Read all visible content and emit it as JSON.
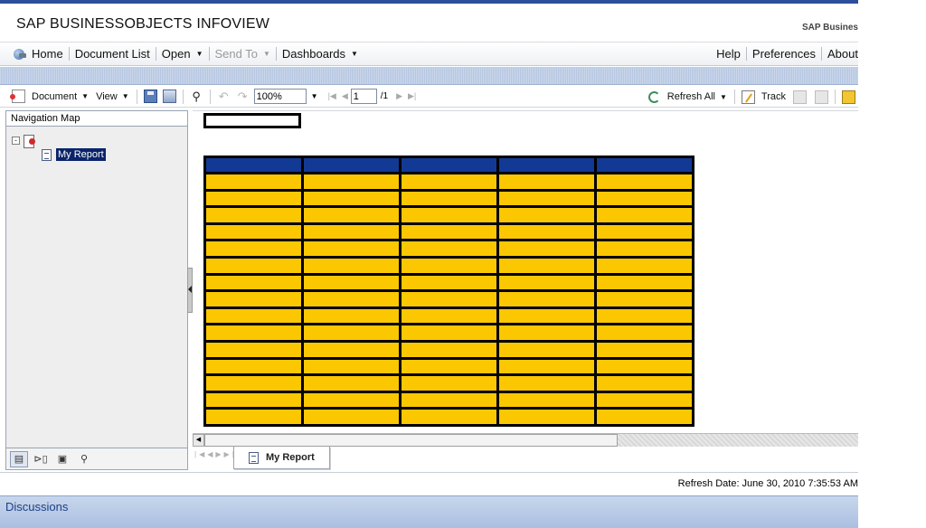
{
  "header": {
    "app_title": "SAP BUSINESSOBJECTS INFOVIEW",
    "logo_text": "SAP Busines"
  },
  "main_nav": {
    "left": [
      {
        "label": "Home"
      },
      {
        "label": "Document List"
      },
      {
        "label": "Open"
      },
      {
        "label": "Send To"
      },
      {
        "label": "Dashboards"
      }
    ],
    "right": [
      {
        "label": "Help"
      },
      {
        "label": "Preferences"
      },
      {
        "label": "About"
      }
    ]
  },
  "toolbar": {
    "document_label": "Document",
    "view_label": "View",
    "zoom_value": "100%",
    "page_value": "1",
    "page_total": "/1",
    "refresh_all_label": "Refresh All",
    "track_label": "Track"
  },
  "navigation_map": {
    "title": "Navigation Map",
    "selected_item": "My Report"
  },
  "report": {
    "columns": 5,
    "body_rows": 15,
    "header_color": "#123a94",
    "cell_color": "#fbc700"
  },
  "report_tab": {
    "label": "My Report"
  },
  "status": {
    "refresh_date": "Refresh Date:  June 30, 2010 7:35:53 AM"
  },
  "discussions": {
    "label": "Discussions"
  }
}
